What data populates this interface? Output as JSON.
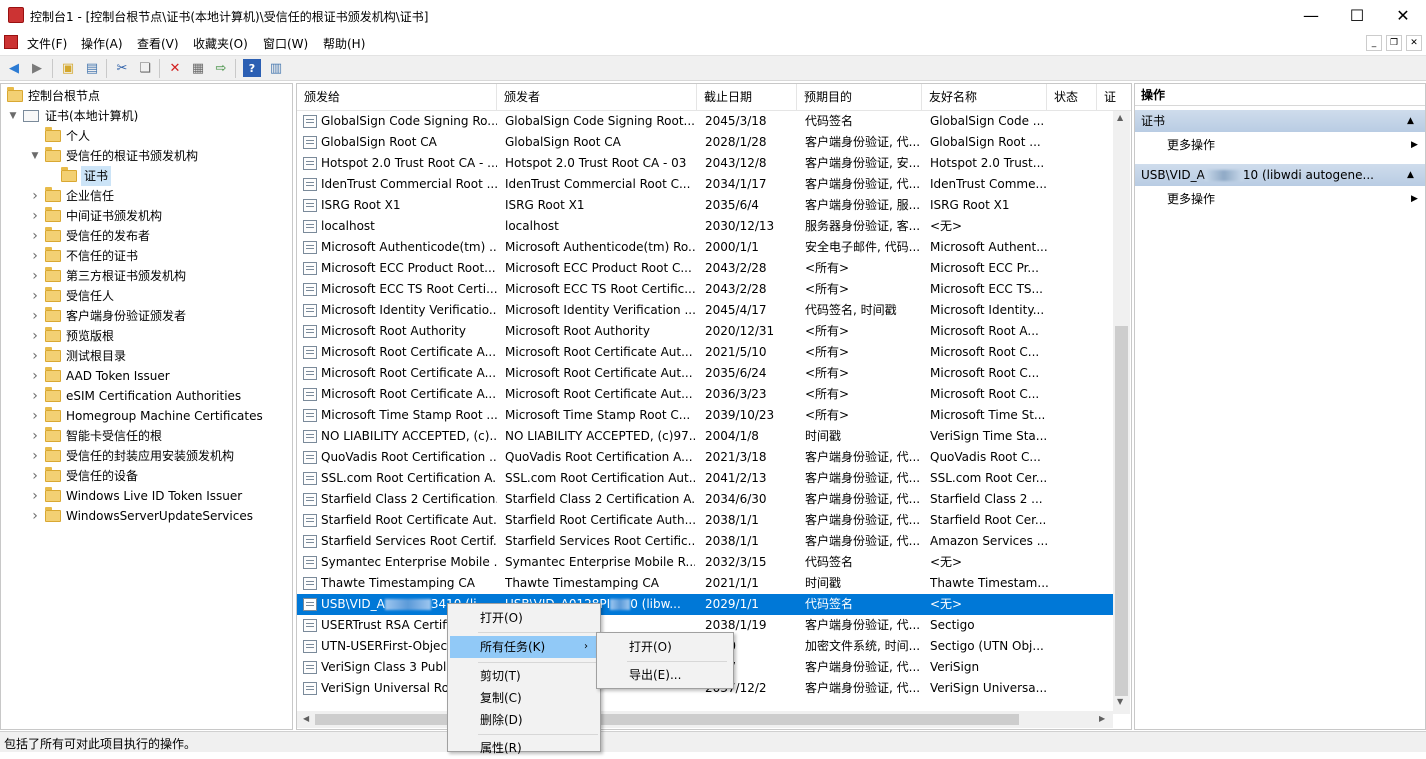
{
  "window": {
    "title": "控制台1 - [控制台根节点\\证书(本地计算机)\\受信任的根证书颁发机构\\证书]",
    "minimize": "—",
    "maximize": "☐",
    "close": "✕"
  },
  "menu": [
    "文件(F)",
    "操作(A)",
    "查看(V)",
    "收藏夹(O)",
    "窗口(W)",
    "帮助(H)"
  ],
  "tree": {
    "root": "控制台根节点",
    "store": "证书(本地计算机)",
    "folders": [
      "个人",
      "受信任的根证书颁发机构",
      "证书",
      "企业信任",
      "中间证书颁发机构",
      "受信任的发布者",
      "不信任的证书",
      "第三方根证书颁发机构",
      "受信任人",
      "客户端身份验证颁发者",
      "预览版根",
      "测试根目录",
      "AAD Token Issuer",
      "eSIM Certification Authorities",
      "Homegroup Machine Certificates",
      "智能卡受信任的根",
      "受信任的封装应用安装颁发机构",
      "受信任的设备",
      "Windows Live ID Token Issuer",
      "WindowsServerUpdateServices"
    ]
  },
  "columns": [
    "颁发给",
    "颁发者",
    "截止日期",
    "预期目的",
    "友好名称",
    "状态",
    "证"
  ],
  "rows": [
    [
      "GlobalSign Code Signing Ro...",
      "GlobalSign Code Signing Root...",
      "2045/3/18",
      "代码签名",
      "GlobalSign Code ..."
    ],
    [
      "GlobalSign Root CA",
      "GlobalSign Root CA",
      "2028/1/28",
      "客户端身份验证, 代...",
      "GlobalSign Root ..."
    ],
    [
      "Hotspot 2.0 Trust Root CA - ...",
      "Hotspot 2.0 Trust Root CA - 03",
      "2043/12/8",
      "客户端身份验证, 安...",
      "Hotspot 2.0 Trust..."
    ],
    [
      "IdenTrust Commercial Root ...",
      "IdenTrust Commercial Root C...",
      "2034/1/17",
      "客户端身份验证, 代...",
      "IdenTrust Comme..."
    ],
    [
      "ISRG Root X1",
      "ISRG Root X1",
      "2035/6/4",
      "客户端身份验证, 服...",
      "ISRG Root X1"
    ],
    [
      "localhost",
      "localhost",
      "2030/12/13",
      "服务器身份验证, 客...",
      "<无>"
    ],
    [
      "Microsoft Authenticode(tm) ...",
      "Microsoft Authenticode(tm) Ro...",
      "2000/1/1",
      "安全电子邮件, 代码...",
      "Microsoft Authent..."
    ],
    [
      "Microsoft ECC Product Root...",
      "Microsoft ECC Product Root C...",
      "2043/2/28",
      "<所有>",
      "Microsoft ECC Pr..."
    ],
    [
      "Microsoft ECC TS Root Certi...",
      "Microsoft ECC TS Root Certific...",
      "2043/2/28",
      "<所有>",
      "Microsoft ECC TS..."
    ],
    [
      "Microsoft Identity Verificatio...",
      "Microsoft Identity Verification ...",
      "2045/4/17",
      "代码签名, 时间戳",
      "Microsoft Identity..."
    ],
    [
      "Microsoft Root Authority",
      "Microsoft Root Authority",
      "2020/12/31",
      "<所有>",
      "Microsoft Root A..."
    ],
    [
      "Microsoft Root Certificate A...",
      "Microsoft Root Certificate Aut...",
      "2021/5/10",
      "<所有>",
      "Microsoft Root C..."
    ],
    [
      "Microsoft Root Certificate A...",
      "Microsoft Root Certificate Aut...",
      "2035/6/24",
      "<所有>",
      "Microsoft Root C..."
    ],
    [
      "Microsoft Root Certificate A...",
      "Microsoft Root Certificate Aut...",
      "2036/3/23",
      "<所有>",
      "Microsoft Root C..."
    ],
    [
      "Microsoft Time Stamp Root ...",
      "Microsoft Time Stamp Root C...",
      "2039/10/23",
      "<所有>",
      "Microsoft Time St..."
    ],
    [
      "NO LIABILITY ACCEPTED, (c)...",
      "NO LIABILITY ACCEPTED, (c)97...",
      "2004/1/8",
      "时间戳",
      "VeriSign Time Sta..."
    ],
    [
      "QuoVadis Root Certification ...",
      "QuoVadis Root Certification A...",
      "2021/3/18",
      "客户端身份验证, 代...",
      "QuoVadis Root C..."
    ],
    [
      "SSL.com Root Certification A...",
      "SSL.com Root Certification Aut...",
      "2041/2/13",
      "客户端身份验证, 代...",
      "SSL.com Root Cer..."
    ],
    [
      "Starfield Class 2 Certification...",
      "Starfield Class 2 Certification A...",
      "2034/6/30",
      "客户端身份验证, 代...",
      "Starfield Class 2 ..."
    ],
    [
      "Starfield Root Certificate Aut...",
      "Starfield Root Certificate Auth...",
      "2038/1/1",
      "客户端身份验证, 代...",
      "Starfield Root Cer..."
    ],
    [
      "Starfield Services Root Certif...",
      "Starfield Services Root Certific...",
      "2038/1/1",
      "客户端身份验证, 代...",
      "Amazon Services ..."
    ],
    [
      "Symantec Enterprise Mobile ...",
      "Symantec Enterprise Mobile R...",
      "2032/3/15",
      "代码签名",
      "<无>"
    ],
    [
      "Thawte Timestamping CA",
      "Thawte Timestamping CA",
      "2021/1/1",
      "时间戳",
      "Thawte Timestam..."
    ],
    [
      "USB\\VID_A",
      "USB\\VID_A0128PI",
      "2029/1/1",
      "代码签名",
      "<无>"
    ],
    [
      "USERTrust RSA Certific",
      "ertification Au...",
      "2038/1/19",
      "客户端身份验证, 代...",
      "Sectigo"
    ],
    [
      "UTN-USERFirst-Object",
      "",
      "/7/10",
      "加密文件系统, 时间...",
      "Sectigo (UTN Obj..."
    ],
    [
      "VeriSign Class 3 Public",
      "",
      "/7/17",
      "客户端身份验证, 代...",
      "VeriSign"
    ],
    [
      "VeriSign Universal Ro",
      "Root Certif...",
      "2037/12/2",
      "客户端身份验证, 代...",
      "VeriSign Universa..."
    ]
  ],
  "selected_row_extra": {
    "issued_to_tail": "3410 (li",
    "issuer_tail": "0 (libw..."
  },
  "actions": {
    "header": "操作",
    "group1": "证书",
    "more1": "更多操作",
    "group2": "USB\\VID_A",
    "group2_tail": "10 (libwdi autogene...",
    "more2": "更多操作"
  },
  "context_menu": {
    "open": "打开(O)",
    "all_tasks": "所有任务(K)",
    "cut": "剪切(T)",
    "copy": "复制(C)",
    "delete": "删除(D)",
    "properties": "属性(R)"
  },
  "submenu": {
    "open": "打开(O)",
    "export": "导出(E)..."
  },
  "status": "包括了所有可对此项目执行的操作。",
  "colors": {
    "selection": "#0078d7",
    "menu_highlight": "#91c9f7",
    "action_group": "#c4d5ea"
  }
}
